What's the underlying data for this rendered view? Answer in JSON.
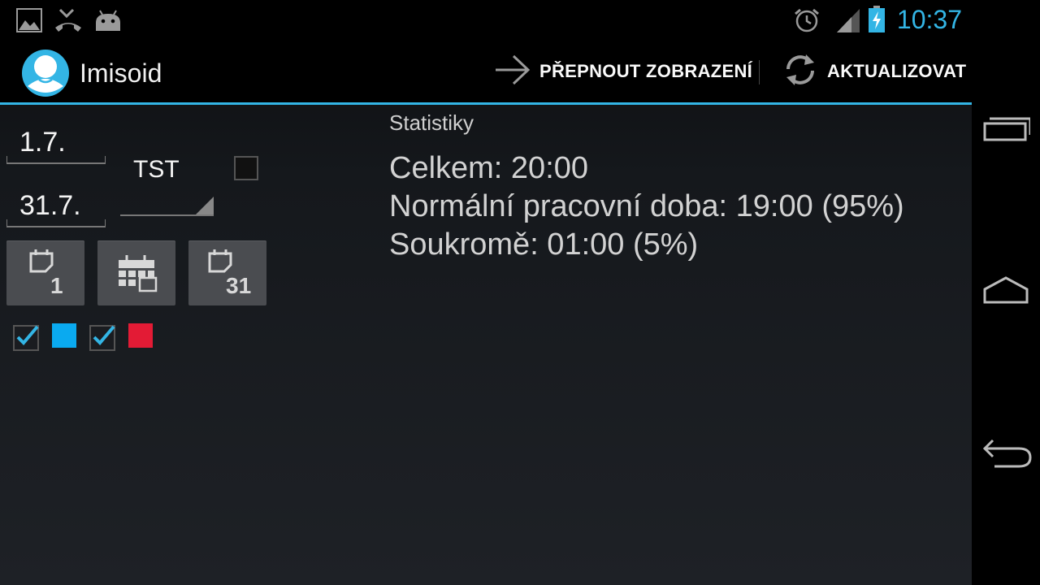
{
  "status_bar": {
    "time": "10:37",
    "icons": [
      "image-notification-icon",
      "missed-call-icon",
      "android-debug-icon",
      "alarm-icon",
      "signal-icon",
      "battery-charging-icon"
    ],
    "accent_color": "#33b5e5"
  },
  "action_bar": {
    "title": "Imisoid",
    "switch_view_label": "PŘEPNOUT ZOBRAZENÍ",
    "refresh_label": "AKTUALIZOVAT"
  },
  "filters": {
    "date_from": "1.7.",
    "date_to": "31.7.",
    "spinner_value": "TST",
    "tst_checked": false,
    "buttons": [
      {
        "name": "first-day-button",
        "icon": "calendar-day-icon",
        "label": "1"
      },
      {
        "name": "month-button",
        "icon": "calendar-month-icon",
        "label": ""
      },
      {
        "name": "last-day-button",
        "icon": "calendar-day-icon",
        "label": "31"
      }
    ],
    "legend": [
      {
        "checked": true,
        "color": "#0aaaf0"
      },
      {
        "checked": true,
        "color": "#e31b35"
      }
    ]
  },
  "stats": {
    "header": "Statistiky",
    "total": "Celkem: 20:00",
    "normal": "Normální pracovní doba: 19:00 (95%)",
    "private": "Soukromě: 01:00 (5%)"
  },
  "nav_bar": {
    "buttons": [
      "recent-apps-icon",
      "home-icon",
      "back-icon"
    ]
  }
}
